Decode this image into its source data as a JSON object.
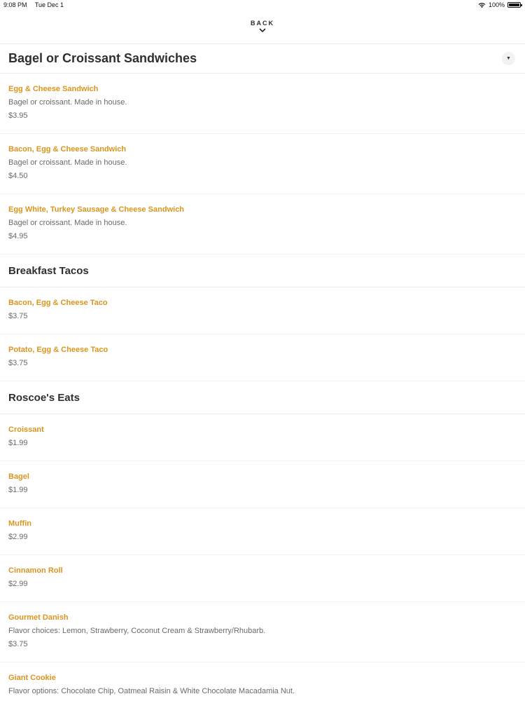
{
  "status_bar": {
    "time": "9:08 PM",
    "date": "Tue Dec 1",
    "battery": "100%",
    "battery_level": 1.0
  },
  "nav": {
    "back_label": "BACK"
  },
  "sections": [
    {
      "title": "Bagel or Croissant Sandwiches",
      "items": [
        {
          "name": "Egg & Cheese Sandwich",
          "description": "Bagel or croissant. Made in house.",
          "price": "$3.95"
        },
        {
          "name": "Bacon, Egg & Cheese Sandwich",
          "description": "Bagel or croissant. Made in house.",
          "price": "$4.50"
        },
        {
          "name": "Egg White, Turkey Sausage & Cheese Sandwich",
          "description": "Bagel or croissant. Made in house.",
          "price": "$4.95"
        }
      ]
    },
    {
      "title": "Breakfast Tacos",
      "items": [
        {
          "name": "Bacon, Egg & Cheese Taco",
          "price": "$3.75"
        },
        {
          "name": "Potato, Egg & Cheese Taco",
          "price": "$3.75"
        }
      ]
    },
    {
      "title": "Roscoe's Eats",
      "items": [
        {
          "name": "Croissant",
          "price": "$1.99"
        },
        {
          "name": "Bagel",
          "price": "$1.99"
        },
        {
          "name": "Muffin",
          "price": "$2.99"
        },
        {
          "name": "Cinnamon Roll",
          "price": "$2.99"
        },
        {
          "name": "Gourmet Danish",
          "description": "Flavor choices: Lemon, Strawberry, Coconut Cream & Strawberry/Rhubarb.",
          "price": "$3.75"
        },
        {
          "name": "Giant Cookie",
          "description": "Flavor options: Chocolate Chip, Oatmeal Raisin & White Chocolate Macadamia Nut."
        }
      ]
    }
  ],
  "colors": {
    "item_name": "#d9951f",
    "text_secondary": "#6a6a6a",
    "title": "#2f2f2f"
  },
  "icons": {
    "back": "chevron-down-icon",
    "section_toggle": "triangle-down-icon",
    "wifi": "wifi-icon",
    "battery": "battery-icon"
  }
}
